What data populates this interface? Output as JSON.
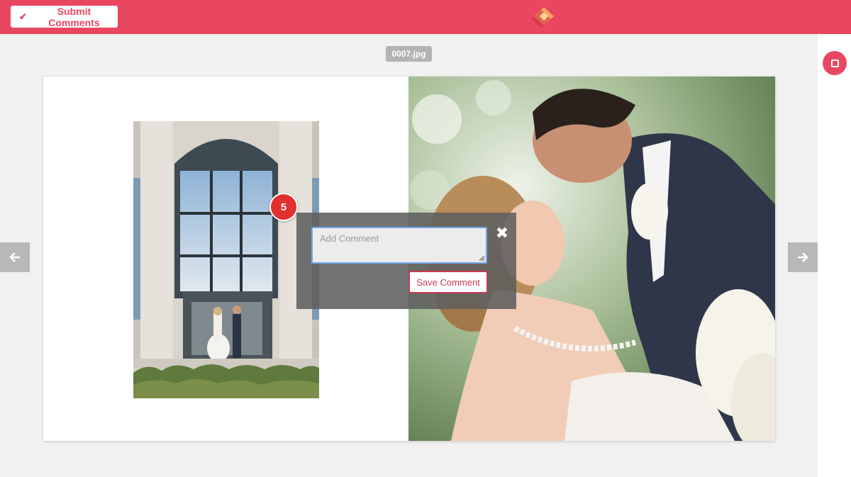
{
  "toolbar": {
    "submit_label": "Submit Comments",
    "submit_icon": "check-icon",
    "logo_icon": "diamond-logo-icon",
    "accent_color": "#e9465f"
  },
  "sidebar": {
    "record_icon": "stop-square-icon"
  },
  "viewer": {
    "filename": "0007.jpg",
    "prev_icon": "arrow-left-icon",
    "next_icon": "arrow-right-icon"
  },
  "comment_badge": {
    "number": "5",
    "color": "#e22f2f"
  },
  "comment_popup": {
    "placeholder": "Add Comment",
    "value": "",
    "close_label": "✖",
    "save_label": "Save Comment"
  }
}
